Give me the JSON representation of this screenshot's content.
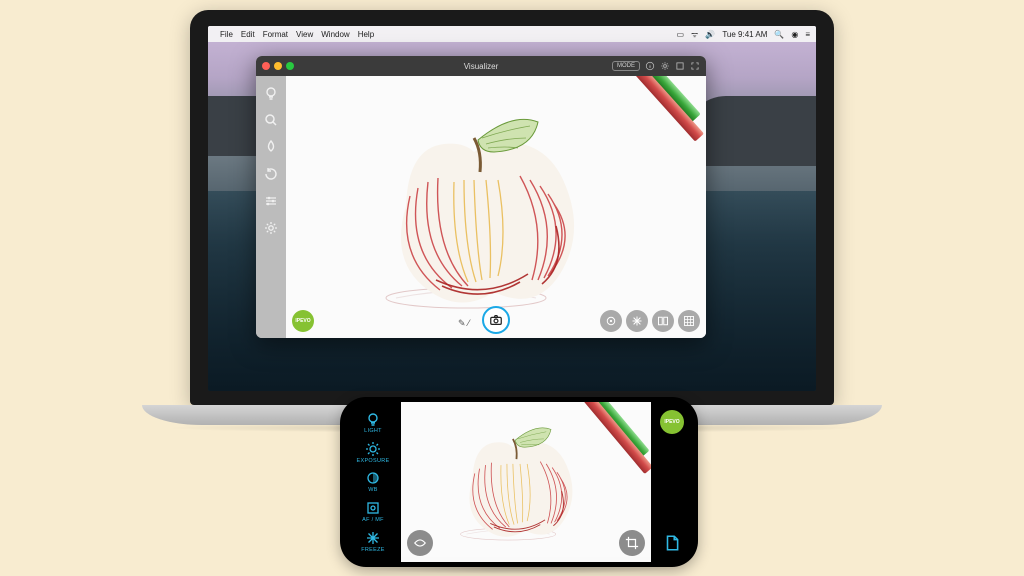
{
  "menubar": {
    "items": [
      "File",
      "Edit",
      "Format",
      "View",
      "Window",
      "Help"
    ],
    "clock": "Tue 9:41 AM"
  },
  "app": {
    "title": "Visualizer",
    "mode_label": "MODE",
    "brand_label": "IPEVO",
    "left_tools": [
      {
        "name": "light",
        "icon": "bulb"
      },
      {
        "name": "zoom",
        "icon": "search"
      },
      {
        "name": "color",
        "icon": "drop"
      },
      {
        "name": "rotate",
        "icon": "rotate"
      },
      {
        "name": "filter",
        "icon": "sliders"
      },
      {
        "name": "settings",
        "icon": "gear"
      }
    ],
    "bottom_tools": [
      {
        "name": "focus",
        "icon": "target"
      },
      {
        "name": "freeze",
        "icon": "snow"
      },
      {
        "name": "mirror",
        "icon": "mirror"
      },
      {
        "name": "grid",
        "icon": "grid"
      }
    ],
    "titlebar_icons": [
      {
        "name": "info",
        "icon": "info"
      },
      {
        "name": "settings",
        "icon": "gear"
      },
      {
        "name": "window",
        "icon": "square"
      },
      {
        "name": "fullscreen",
        "icon": "expand"
      }
    ],
    "draw_indicator": "✎ ⁄"
  },
  "phone": {
    "left_tools": [
      {
        "name": "light",
        "label": "LIGHT"
      },
      {
        "name": "exposure",
        "label": "EXPOSURE"
      },
      {
        "name": "wb",
        "label": "WB"
      },
      {
        "name": "afmf",
        "label": "AF / MF"
      },
      {
        "name": "freeze",
        "label": "FREEZE"
      }
    ],
    "brand_label": "IPEVO"
  }
}
